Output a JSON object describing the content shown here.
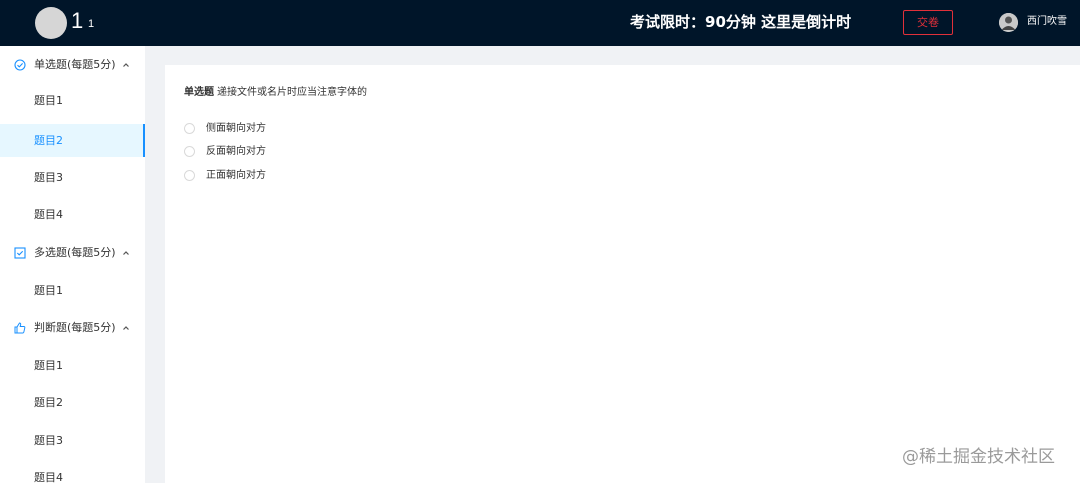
{
  "header": {
    "brand_big": "1",
    "brand_small": "1",
    "timer_text": "考试限时：90分钟 这里是倒计时",
    "submit_label": "交卷",
    "user_name": "西门吹雪",
    "accent_color": "#e0303a"
  },
  "sidebar": {
    "groups": [
      {
        "title": "单选题(每题5分)",
        "icon": "check-circle-icon",
        "expanded": true,
        "items": [
          "题目1",
          "题目2",
          "题目3",
          "题目4"
        ]
      },
      {
        "title": "多选题(每题5分)",
        "icon": "checkbox-icon",
        "expanded": true,
        "items": [
          "题目1"
        ]
      },
      {
        "title": "判断题(每题5分)",
        "icon": "thumbs-up-icon",
        "expanded": true,
        "items": [
          "题目1",
          "题目2",
          "题目3",
          "题目4"
        ]
      }
    ],
    "active_item": "单选题 / 题目2",
    "active_color": "#1890ff"
  },
  "question": {
    "type_label": "单选题",
    "text": "递接文件或名片时应当注意字体的",
    "options": [
      "侧面朝向对方",
      "反面朝向对方",
      "正面朝向对方"
    ]
  },
  "watermark": "@稀土掘金技术社区"
}
